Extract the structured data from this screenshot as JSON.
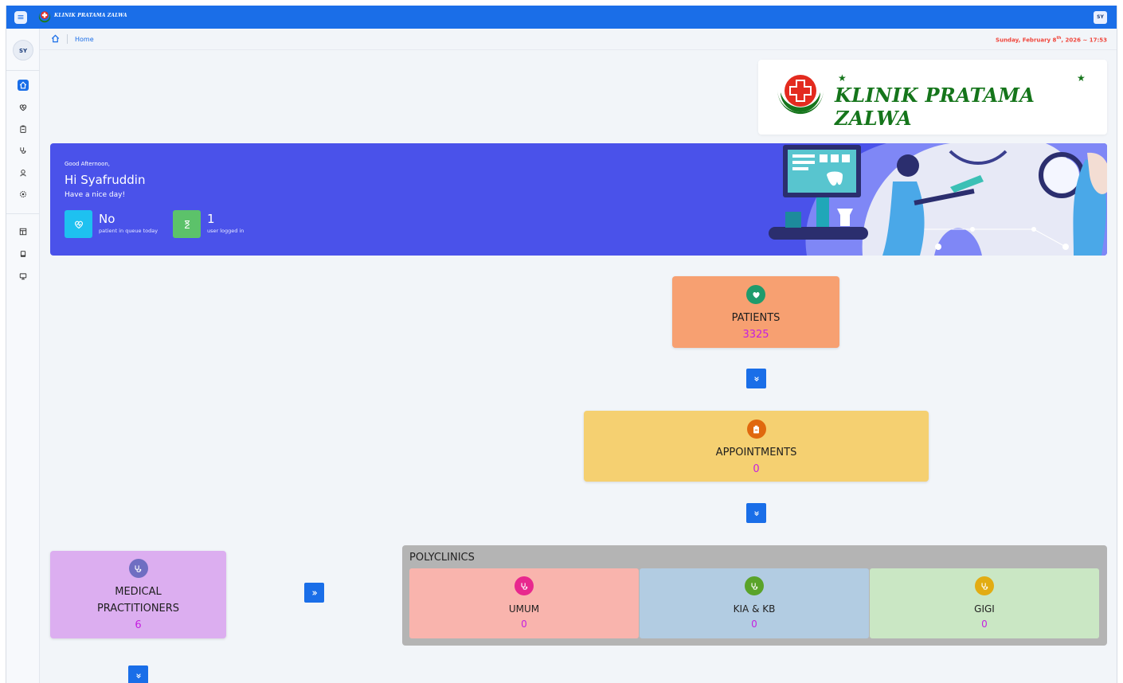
{
  "app": {
    "brand_short": "KLINIK PRATAMA ZALWA",
    "user_initials": "SY",
    "menu_icon": "hamburger-icon"
  },
  "sidebar": {
    "avatar_initials": "SY",
    "items": [
      {
        "icon": "home-icon",
        "active": true
      },
      {
        "icon": "heart-pulse-icon",
        "active": false
      },
      {
        "icon": "calendar-clip-icon",
        "active": false
      },
      {
        "icon": "stethoscope-icon",
        "active": false
      },
      {
        "icon": "person-badge-icon",
        "active": false
      },
      {
        "icon": "settings-icon",
        "active": false
      },
      {
        "icon": "layout-icon",
        "active": false
      },
      {
        "icon": "tablet-icon",
        "active": false
      },
      {
        "icon": "monitor-icon",
        "active": false
      }
    ]
  },
  "breadcrumb": {
    "home_label": "Home"
  },
  "datetime": {
    "prefix": "Sunday, February 8",
    "suffix": "th",
    "rest": ", 2026 ~ 17:53"
  },
  "logo": {
    "name": "KLINIK PRATAMA ZALWA"
  },
  "greeting": {
    "salutation": "Good Afternoon,",
    "name": "Hi Syafruddin",
    "subtitle": "Have a nice day!",
    "stats": [
      {
        "value": "No",
        "label": "patient in queue today",
        "color": "#1ec1f0",
        "icon": "heart-pulse-icon"
      },
      {
        "value": "1",
        "label": "user logged in",
        "color": "#5cc26a",
        "icon": "hourglass-icon"
      }
    ]
  },
  "flow": {
    "patients": {
      "title": "PATIENTS",
      "value": "3325",
      "bg": "#f7a071",
      "icon_bg": "#1f9b6c",
      "icon": "heart-icon"
    },
    "appointments": {
      "title": "APPOINTMENTS",
      "value": "0",
      "bg": "#f5d071",
      "icon_bg": "#e0680e",
      "icon": "clipboard-icon"
    },
    "practitioners": {
      "title_line1": "MEDICAL",
      "title_line2": "PRACTITIONERS",
      "value": "6",
      "bg": "#dcaef0",
      "icon_bg": "#6f6ec2",
      "icon": "stethoscope-icon"
    },
    "polyclinics": {
      "title": "POLYCLINICS",
      "items": [
        {
          "name": "UMUM",
          "value": "0",
          "bg": "#f9b4ad",
          "icon_bg": "#e8288e",
          "icon": "stethoscope-icon"
        },
        {
          "name": "KIA & KB",
          "value": "0",
          "bg": "#b2cce2",
          "icon_bg": "#5aa329",
          "icon": "stethoscope-icon"
        },
        {
          "name": "GIGI",
          "value": "0",
          "bg": "#cae7c4",
          "icon_bg": "#e2ac12",
          "icon": "stethoscope-icon"
        }
      ]
    }
  },
  "colors": {
    "primary": "#1a6ee8",
    "banner": "#4a52ea",
    "value_text": "#c51fe0",
    "date_text": "#f0463c",
    "brand_green": "#15751b"
  }
}
